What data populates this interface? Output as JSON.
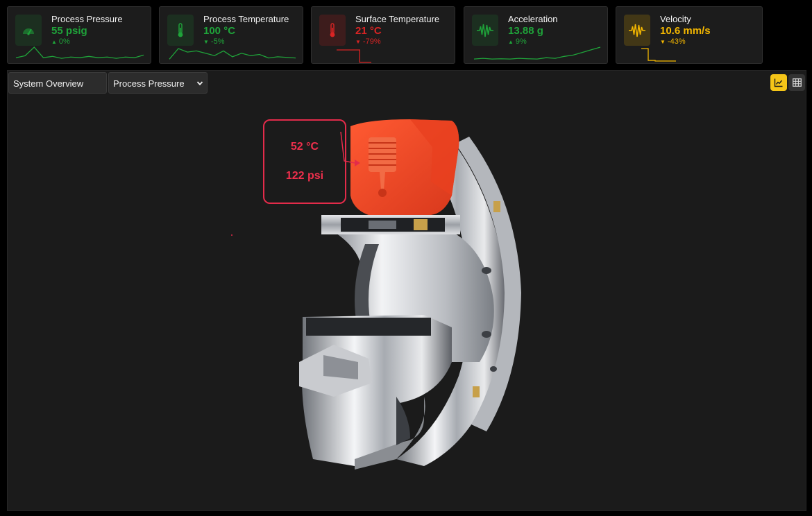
{
  "colors": {
    "background": "#000000",
    "panel": "#1b1b1b",
    "card": "#1c1c1c",
    "active_border": "#e8c21a",
    "good": "#1fa43a",
    "bad": "#d92424",
    "warn": "#f5b800",
    "callout": "#e32b4a",
    "highlight_part": "#f04624"
  },
  "kpis": [
    {
      "title": "Process Pressure",
      "value": "55 psig",
      "change": "0%",
      "direction": "up",
      "status": "good",
      "icon": "gauge-icon",
      "active": true,
      "trend": [
        0.2,
        0.35,
        1.0,
        0.2,
        0.3,
        0.15,
        0.25,
        0.2,
        0.3,
        0.2,
        0.25,
        0.15,
        0.25,
        0.2,
        0.4
      ]
    },
    {
      "title": "Process Temperature",
      "value": "100 °C",
      "change": "-5%",
      "direction": "down",
      "status": "good",
      "icon": "thermometer-icon",
      "active": false,
      "trend": [
        0.1,
        1.0,
        0.7,
        0.8,
        0.6,
        0.4,
        0.8,
        0.3,
        0.6,
        0.4,
        0.5,
        0.2,
        0.3,
        0.25,
        0.2
      ]
    },
    {
      "title": "Surface Temperature",
      "value": "21 °C",
      "change": "-79%",
      "direction": "down",
      "status": "bad",
      "icon": "thermometer-icon",
      "active": false,
      "trend": [
        1.0,
        1.0,
        1.0,
        1.0,
        0.0,
        0.0,
        0.0
      ]
    },
    {
      "title": "Acceleration",
      "value": "13.88 g",
      "change": "9%",
      "direction": "up",
      "status": "good",
      "icon": "vibration-icon",
      "active": false,
      "trend": [
        0.1,
        0.15,
        0.1,
        0.12,
        0.1,
        0.15,
        0.12,
        0.1,
        0.2,
        0.15,
        0.3,
        0.4,
        0.6,
        0.8,
        1.0
      ]
    },
    {
      "title": "Velocity",
      "value": "10.6 mm/s",
      "change": "-43%",
      "direction": "down",
      "status": "warn",
      "icon": "vibration-icon",
      "active": false,
      "trend": [
        1.0,
        0.05,
        0.0,
        0.0,
        0.0,
        0.0
      ]
    }
  ],
  "toolbar": {
    "overview_label": "System Overview",
    "metric_select": "Process Pressure",
    "view_chart_icon": "line-chart-icon",
    "view_table_icon": "table-icon"
  },
  "callout": {
    "temperature": "52 °C",
    "pressure": "122 psi"
  }
}
